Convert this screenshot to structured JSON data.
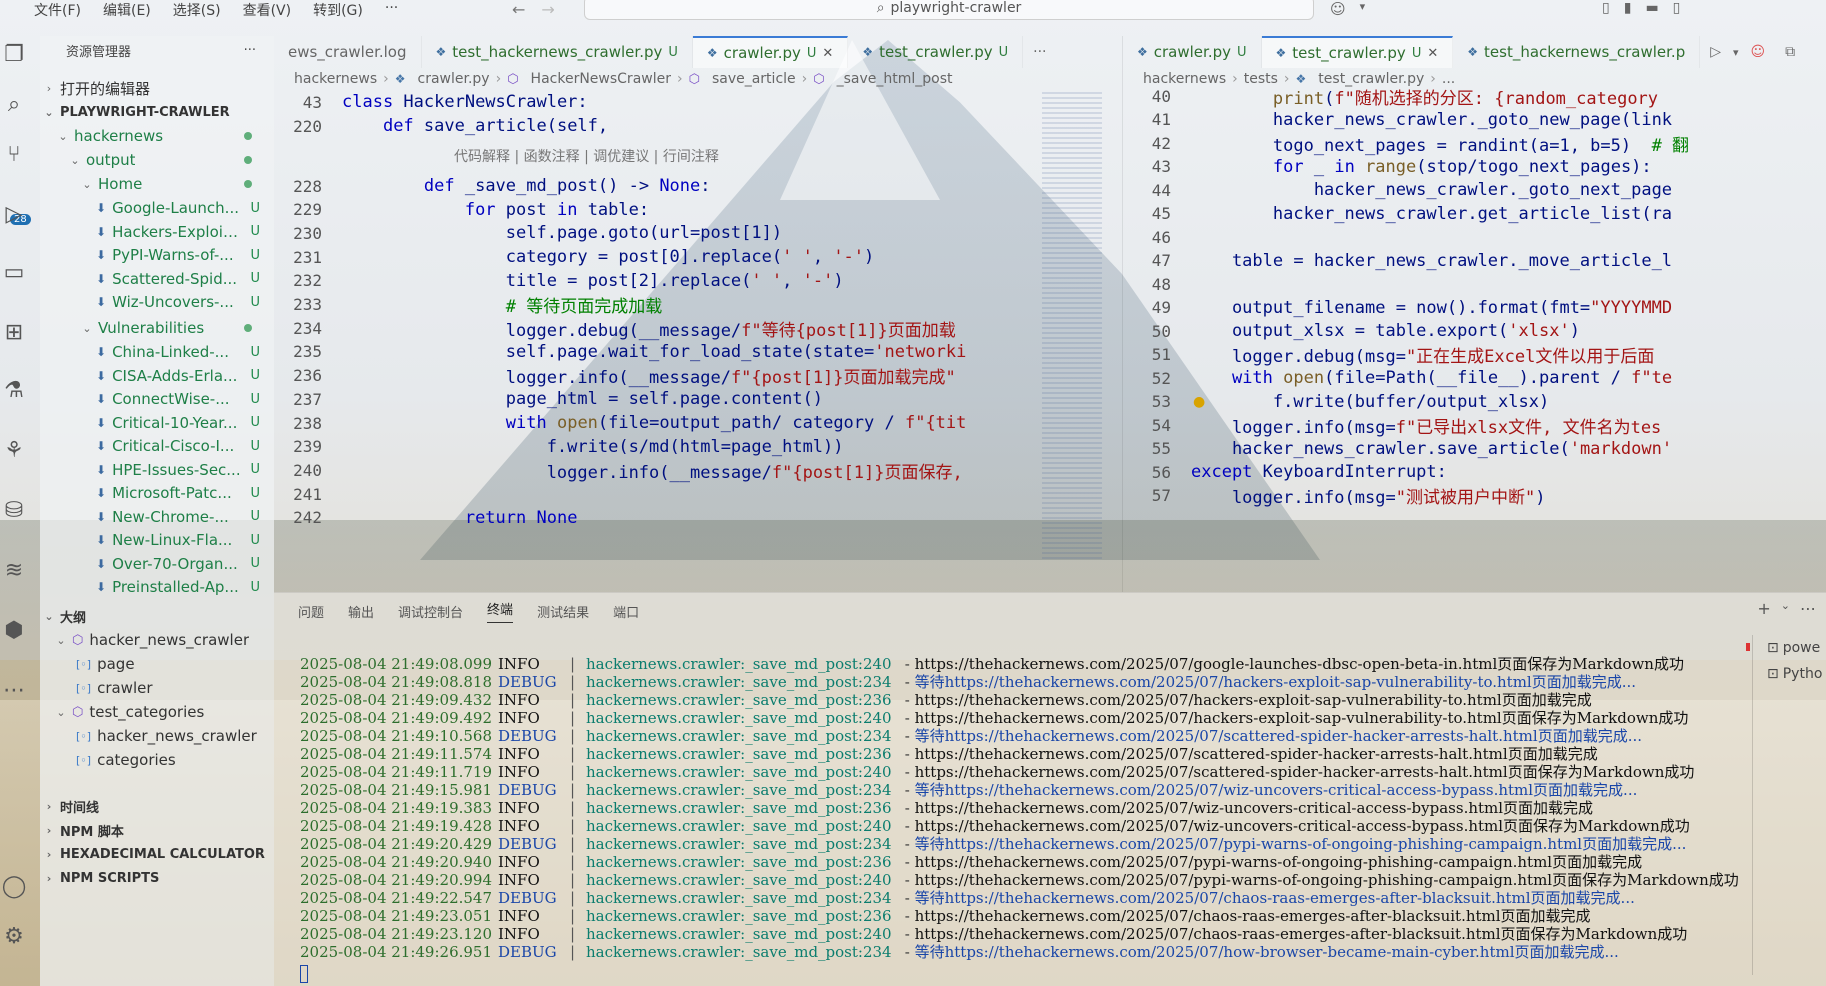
{
  "menu": [
    "文件(F)",
    "编辑(E)",
    "选择(S)",
    "查看(V)",
    "转到(G)"
  ],
  "menu_more": "···",
  "search_title": "playwright-crawler",
  "explorer": {
    "header": "资源管理器",
    "more": "···",
    "open_editors": "打开的编辑器",
    "project": "PLAYWRIGHT-CRAWLER",
    "hackernews": "hackernews",
    "output": "output",
    "home": "Home",
    "home_files": [
      "Google-Launch...",
      "Hackers-Exploit...",
      "PyPI-Warns-of-...",
      "Scattered-Spid...",
      "Wiz-Uncovers-..."
    ],
    "vulnerabilities": "Vulnerabilities",
    "vuln_files": [
      "China-Linked-...",
      "CISA-Adds-Erla...",
      "ConnectWise-...",
      "Critical-10-Year...",
      "Critical-Cisco-I...",
      "HPE-Issues-Sec...",
      "Microsoft-Patc...",
      "New-Chrome-...",
      "New-Linux-Fla...",
      "Over-70-Organ...",
      "Preinstalled-Ap..."
    ],
    "untracked": "U",
    "outline": "大纲",
    "outline_items": {
      "class1": "hacker_news_crawler",
      "field1": "page",
      "field2": "crawler",
      "class2": "test_categories",
      "field3": "hacker_news_crawler",
      "field4": "categories"
    },
    "timeline": "时间线",
    "npm_cn": "NPM 脚本",
    "hex": "HEXADECIMAL CALCULATOR",
    "npm": "NPM SCRIPTS"
  },
  "activity": {
    "scm_badge": "28"
  },
  "left_editor": {
    "tabs": [
      {
        "label": "ews_crawler.log",
        "status": ""
      },
      {
        "label": "test_hackernews_crawler.py",
        "status": "U"
      },
      {
        "label": "crawler.py",
        "status": "U"
      },
      {
        "label": "test_crawler.py",
        "status": "U"
      }
    ],
    "tab_more": "···",
    "breadcrumb": [
      "hackernews",
      "crawler.py",
      "HackerNewsCrawler",
      "save_article",
      "_save_html_post"
    ],
    "codelens": "代码解释 | 函数注释 | 调优建议 | 行间注释",
    "lines": [
      {
        "n": "43",
        "code": "class HackerNewsCrawler:"
      },
      {
        "n": "220",
        "code": "    def save_article(self,"
      },
      {
        "n": "228",
        "code": "        def _save_md_post() -> None:"
      },
      {
        "n": "229",
        "code": "            for post in table:"
      },
      {
        "n": "230",
        "code": "                self.page.goto(url=post[1])"
      },
      {
        "n": "231",
        "code": "                category = post[0].replace(' ', '-')"
      },
      {
        "n": "232",
        "code": "                title = post[2].replace(' ', '-')"
      },
      {
        "n": "233",
        "code": "                # 等待页面完成加载"
      },
      {
        "n": "234",
        "code": "                logger.debug(__message/f\"等待{post[1]}页面加载"
      },
      {
        "n": "235",
        "code": "                self.page.wait_for_load_state(state='networki"
      },
      {
        "n": "236",
        "code": "                logger.info(__message/f\"{post[1]}页面加载完成\""
      },
      {
        "n": "237",
        "code": "                page_html = self.page.content()"
      },
      {
        "n": "238",
        "code": "                with open(file=output_path/ category / f\"{tit"
      },
      {
        "n": "239",
        "code": "                    f.write(s/md(html=page_html))"
      },
      {
        "n": "240",
        "code": "                    logger.info(__message/f\"{post[1]}页面保存,"
      },
      {
        "n": "241",
        "code": ""
      },
      {
        "n": "242",
        "code": "            return None"
      }
    ]
  },
  "right_editor": {
    "tabs": [
      {
        "label": "crawler.py",
        "status": "U"
      },
      {
        "label": "test_crawler.py",
        "status": "U"
      },
      {
        "label": "test_hackernews_crawler.p",
        "status": ""
      }
    ],
    "breadcrumb": [
      "hackernews",
      "tests",
      "test_crawler.py",
      "..."
    ],
    "lines": [
      {
        "n": "40",
        "code": "        print(f\"随机选择的分区: {random_category"
      },
      {
        "n": "41",
        "code": "        hacker_news_crawler._goto_new_page(link"
      },
      {
        "n": "42",
        "code": "        togo_next_pages = randint(a=1, b=5)  # 翻"
      },
      {
        "n": "43",
        "code": "        for _ in range(stop/togo_next_pages):"
      },
      {
        "n": "44",
        "code": "            hacker_news_crawler._goto_next_page"
      },
      {
        "n": "45",
        "code": "        hacker_news_crawler.get_article_list(ra"
      },
      {
        "n": "46",
        "code": ""
      },
      {
        "n": "47",
        "code": "    table = hacker_news_crawler._move_article_l"
      },
      {
        "n": "48",
        "code": ""
      },
      {
        "n": "49",
        "code": "    output_filename = now().format(fmt=\"YYYYMMD"
      },
      {
        "n": "50",
        "code": "    output_xlsx = table.export('xlsx')"
      },
      {
        "n": "51",
        "code": "    logger.debug(msg=\"正在生成Excel文件以用于后面"
      },
      {
        "n": "52",
        "code": "    with open(file=Path(__file__).parent / f\"te"
      },
      {
        "n": "53",
        "code": "        f.write(buffer/output_xlsx)"
      },
      {
        "n": "54",
        "code": "    logger.info(msg=f\"已导出xlsx文件, 文件名为tes"
      },
      {
        "n": "55",
        "code": "    hacker_news_crawler.save_article('markdown'"
      },
      {
        "n": "56",
        "code": "except KeyboardInterrupt:"
      },
      {
        "n": "57",
        "code": "    logger.info(msg=\"测试被用户中断\")"
      }
    ]
  },
  "panel": {
    "tabs": [
      "问题",
      "输出",
      "调试控制台",
      "终端",
      "测试结果",
      "端口"
    ],
    "active_tab": "终端",
    "terminals": [
      "powe",
      "Pytho"
    ],
    "logs": [
      {
        "ts": "2025-08-04 21:49:08.099",
        "lvl": "INFO",
        "mod": "hackernews.crawler:_save_md_post:240",
        "msg": "https://thehackernews.com/2025/07/google-launches-dbsc-open-beta-in.html页面保存为Markdown成功"
      },
      {
        "ts": "2025-08-04 21:49:08.818",
        "lvl": "DEBUG",
        "mod": "hackernews.crawler:_save_md_post:234",
        "msg": "等待https://thehackernews.com/2025/07/hackers-exploit-sap-vulnerability-to.html页面加载完成..."
      },
      {
        "ts": "2025-08-04 21:49:09.432",
        "lvl": "INFO",
        "mod": "hackernews.crawler:_save_md_post:236",
        "msg": "https://thehackernews.com/2025/07/hackers-exploit-sap-vulnerability-to.html页面加载完成"
      },
      {
        "ts": "2025-08-04 21:49:09.492",
        "lvl": "INFO",
        "mod": "hackernews.crawler:_save_md_post:240",
        "msg": "https://thehackernews.com/2025/07/hackers-exploit-sap-vulnerability-to.html页面保存为Markdown成功"
      },
      {
        "ts": "2025-08-04 21:49:10.568",
        "lvl": "DEBUG",
        "mod": "hackernews.crawler:_save_md_post:234",
        "msg": "等待https://thehackernews.com/2025/07/scattered-spider-hacker-arrests-halt.html页面加载完成..."
      },
      {
        "ts": "2025-08-04 21:49:11.574",
        "lvl": "INFO",
        "mod": "hackernews.crawler:_save_md_post:236",
        "msg": "https://thehackernews.com/2025/07/scattered-spider-hacker-arrests-halt.html页面加载完成"
      },
      {
        "ts": "2025-08-04 21:49:11.719",
        "lvl": "INFO",
        "mod": "hackernews.crawler:_save_md_post:240",
        "msg": "https://thehackernews.com/2025/07/scattered-spider-hacker-arrests-halt.html页面保存为Markdown成功"
      },
      {
        "ts": "2025-08-04 21:49:15.981",
        "lvl": "DEBUG",
        "mod": "hackernews.crawler:_save_md_post:234",
        "msg": "等待https://thehackernews.com/2025/07/wiz-uncovers-critical-access-bypass.html页面加载完成..."
      },
      {
        "ts": "2025-08-04 21:49:19.383",
        "lvl": "INFO",
        "mod": "hackernews.crawler:_save_md_post:236",
        "msg": "https://thehackernews.com/2025/07/wiz-uncovers-critical-access-bypass.html页面加载完成"
      },
      {
        "ts": "2025-08-04 21:49:19.428",
        "lvl": "INFO",
        "mod": "hackernews.crawler:_save_md_post:240",
        "msg": "https://thehackernews.com/2025/07/wiz-uncovers-critical-access-bypass.html页面保存为Markdown成功"
      },
      {
        "ts": "2025-08-04 21:49:20.429",
        "lvl": "DEBUG",
        "mod": "hackernews.crawler:_save_md_post:234",
        "msg": "等待https://thehackernews.com/2025/07/pypi-warns-of-ongoing-phishing-campaign.html页面加载完成..."
      },
      {
        "ts": "2025-08-04 21:49:20.940",
        "lvl": "INFO",
        "mod": "hackernews.crawler:_save_md_post:236",
        "msg": "https://thehackernews.com/2025/07/pypi-warns-of-ongoing-phishing-campaign.html页面加载完成"
      },
      {
        "ts": "2025-08-04 21:49:20.994",
        "lvl": "INFO",
        "mod": "hackernews.crawler:_save_md_post:240",
        "msg": "https://thehackernews.com/2025/07/pypi-warns-of-ongoing-phishing-campaign.html页面保存为Markdown成功"
      },
      {
        "ts": "2025-08-04 21:49:22.547",
        "lvl": "DEBUG",
        "mod": "hackernews.crawler:_save_md_post:234",
        "msg": "等待https://thehackernews.com/2025/07/chaos-raas-emerges-after-blacksuit.html页面加载完成..."
      },
      {
        "ts": "2025-08-04 21:49:23.051",
        "lvl": "INFO",
        "mod": "hackernews.crawler:_save_md_post:236",
        "msg": "https://thehackernews.com/2025/07/chaos-raas-emerges-after-blacksuit.html页面加载完成"
      },
      {
        "ts": "2025-08-04 21:49:23.120",
        "lvl": "INFO",
        "mod": "hackernews.crawler:_save_md_post:240",
        "msg": "https://thehackernews.com/2025/07/chaos-raas-emerges-after-blacksuit.html页面保存为Markdown成功"
      },
      {
        "ts": "2025-08-04 21:49:26.951",
        "lvl": "DEBUG",
        "mod": "hackernews.crawler:_save_md_post:234",
        "msg": "等待https://thehackernews.com/2025/07/how-browser-became-main-cyber.html页面加载完成..."
      }
    ]
  }
}
